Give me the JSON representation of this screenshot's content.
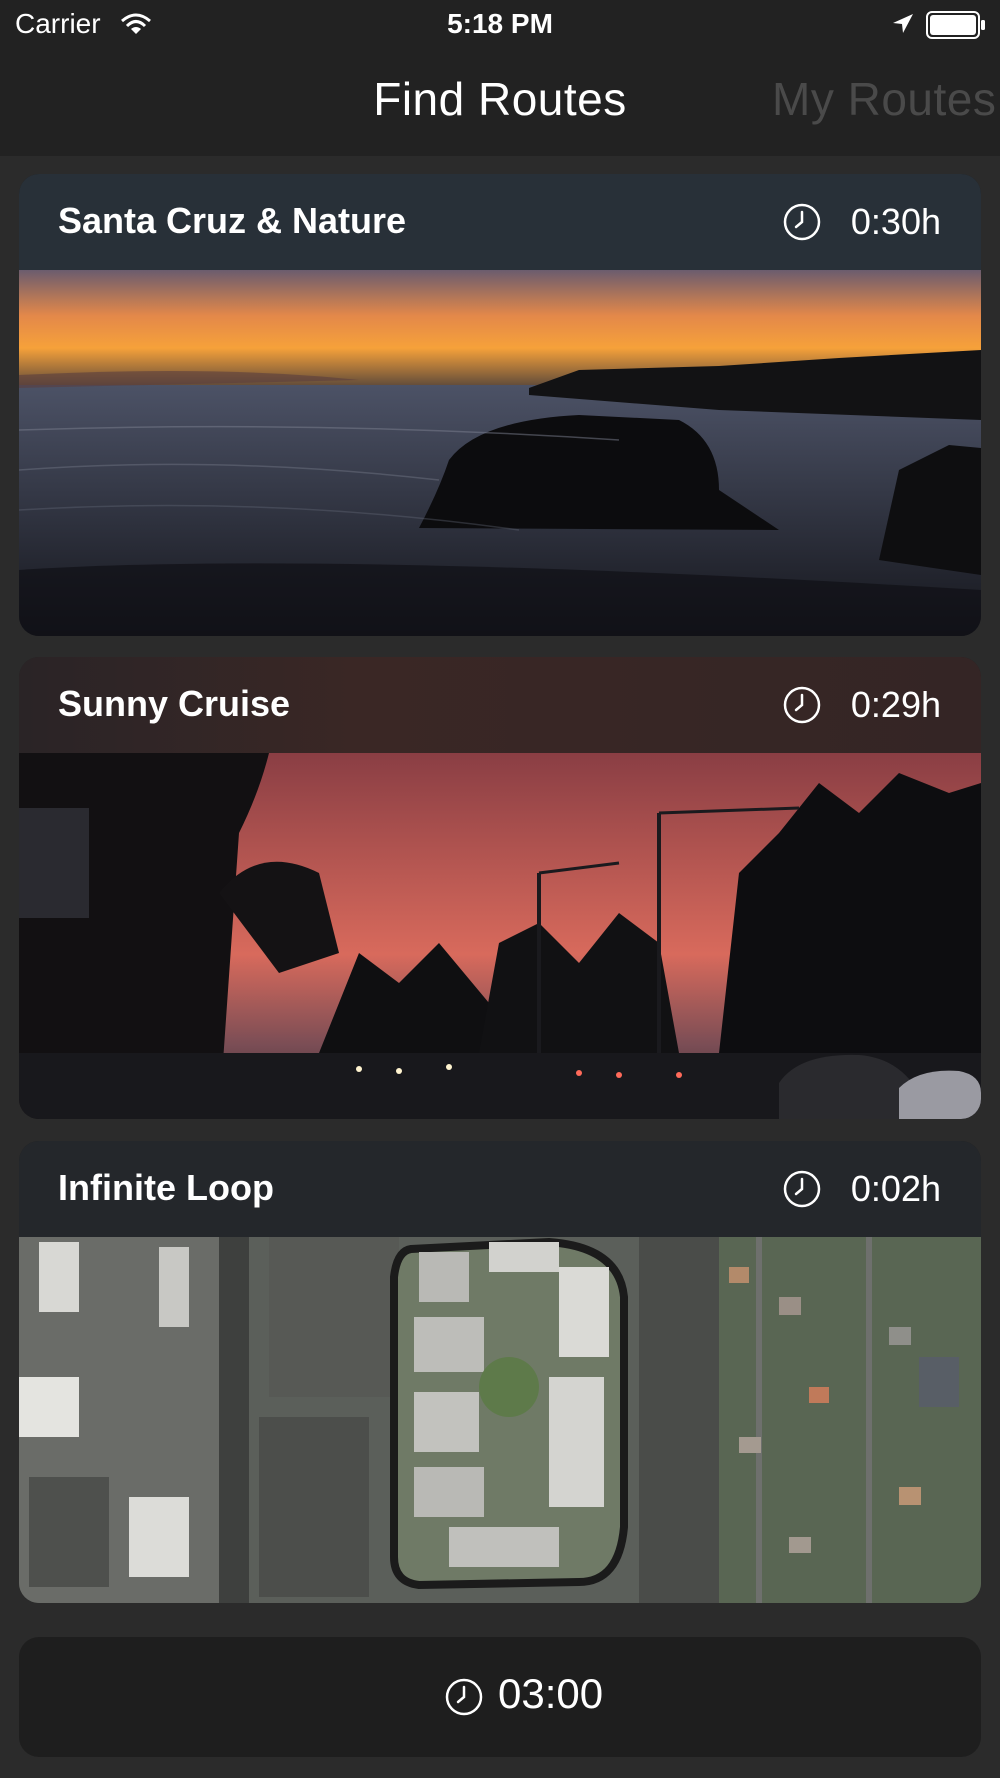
{
  "status_bar": {
    "carrier": "Carrier",
    "time": "5:18 PM",
    "wifi_icon": "wifi-icon",
    "location_icon": "location-arrow-icon",
    "battery_icon": "battery-icon"
  },
  "tabs": [
    {
      "label": "Find Routes",
      "active": true
    },
    {
      "label": "My Routes",
      "active": false
    }
  ],
  "routes": [
    {
      "title": "Santa Cruz & Nature",
      "duration": "0:30h",
      "icon": "clock-icon",
      "image": "sunset-ocean-rocks-photo"
    },
    {
      "title": "Sunny Cruise",
      "duration": "0:29h",
      "icon": "clock-icon",
      "image": "sunset-street-traffic-photo"
    },
    {
      "title": "Infinite Loop",
      "duration": "0:02h",
      "icon": "clock-icon",
      "image": "aerial-campus-map-photo"
    }
  ],
  "bottom_bar": {
    "icon": "clock-icon",
    "time": "03:00"
  },
  "colors": {
    "background": "#2b2b2b",
    "bar": "#222222",
    "inactive_tab": "#4a4a4a",
    "text": "#ffffff"
  }
}
